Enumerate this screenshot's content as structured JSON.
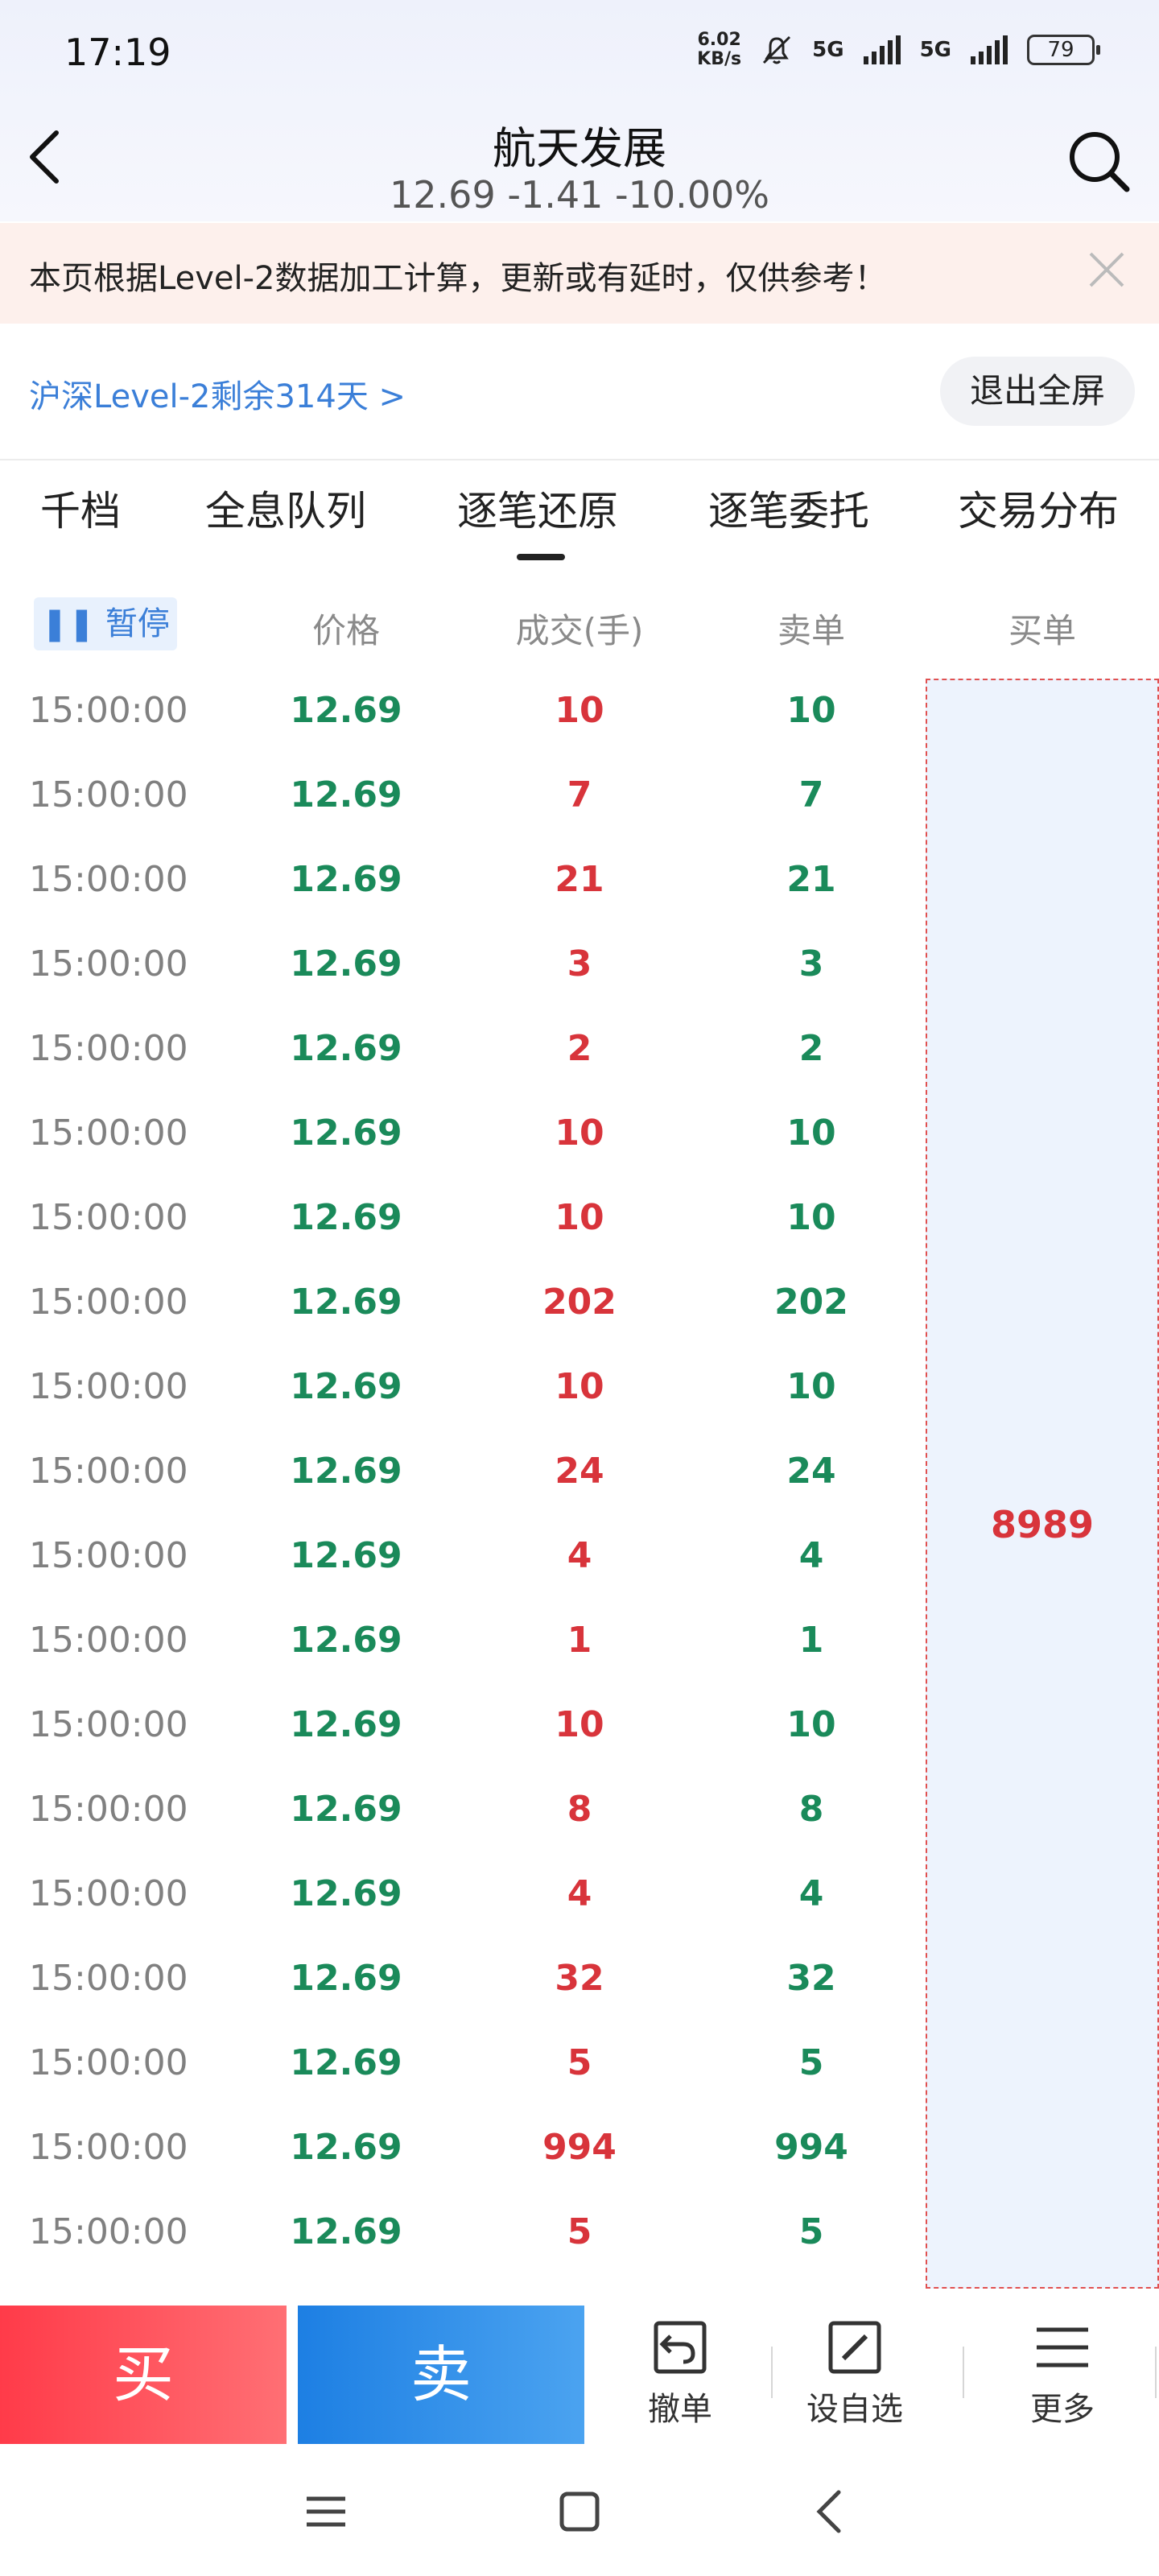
{
  "status_bar": {
    "time": "17:19",
    "net_speed_value": "6.02",
    "net_speed_unit": "KB/s",
    "signal1": "5G",
    "signal2": "5G",
    "battery": "79",
    "icons": [
      "bell-muted-icon",
      "signal-icon",
      "signal-icon",
      "battery-icon"
    ]
  },
  "header": {
    "title": "航天发展",
    "quote": "12.69 -1.41 -10.00%",
    "back_icon": "chevron-left-icon",
    "search_icon": "search-icon"
  },
  "notice": {
    "text": "本页根据Level-2数据加工计算，更新或有延时，仅供参考！",
    "close_icon": "close-icon"
  },
  "level2": {
    "link": "沪深Level-2剩余314天 >",
    "exit_fullscreen": "退出全屏"
  },
  "tabs": [
    {
      "label": "千档"
    },
    {
      "label": "全息队列"
    },
    {
      "label": "逐笔还原",
      "active": true
    },
    {
      "label": "逐笔委托"
    },
    {
      "label": "交易分布"
    }
  ],
  "table": {
    "pause_label": "暂停",
    "headers": [
      "价格",
      "成交(手)",
      "卖单",
      "买单"
    ],
    "rows": [
      {
        "time": "15:00:00",
        "price": "12.69",
        "volume": "10",
        "sell": "10"
      },
      {
        "time": "15:00:00",
        "price": "12.69",
        "volume": "7",
        "sell": "7"
      },
      {
        "time": "15:00:00",
        "price": "12.69",
        "volume": "21",
        "sell": "21"
      },
      {
        "time": "15:00:00",
        "price": "12.69",
        "volume": "3",
        "sell": "3"
      },
      {
        "time": "15:00:00",
        "price": "12.69",
        "volume": "2",
        "sell": "2"
      },
      {
        "time": "15:00:00",
        "price": "12.69",
        "volume": "10",
        "sell": "10"
      },
      {
        "time": "15:00:00",
        "price": "12.69",
        "volume": "10",
        "sell": "10"
      },
      {
        "time": "15:00:00",
        "price": "12.69",
        "volume": "202",
        "sell": "202"
      },
      {
        "time": "15:00:00",
        "price": "12.69",
        "volume": "10",
        "sell": "10"
      },
      {
        "time": "15:00:00",
        "price": "12.69",
        "volume": "24",
        "sell": "24"
      },
      {
        "time": "15:00:00",
        "price": "12.69",
        "volume": "4",
        "sell": "4"
      },
      {
        "time": "15:00:00",
        "price": "12.69",
        "volume": "1",
        "sell": "1"
      },
      {
        "time": "15:00:00",
        "price": "12.69",
        "volume": "10",
        "sell": "10"
      },
      {
        "time": "15:00:00",
        "price": "12.69",
        "volume": "8",
        "sell": "8"
      },
      {
        "time": "15:00:00",
        "price": "12.69",
        "volume": "4",
        "sell": "4"
      },
      {
        "time": "15:00:00",
        "price": "12.69",
        "volume": "32",
        "sell": "32"
      },
      {
        "time": "15:00:00",
        "price": "12.69",
        "volume": "5",
        "sell": "5"
      },
      {
        "time": "15:00:00",
        "price": "12.69",
        "volume": "994",
        "sell": "994"
      },
      {
        "time": "15:00:00",
        "price": "12.69",
        "volume": "5",
        "sell": "5"
      }
    ],
    "buy_order": "8989"
  },
  "actions": {
    "buy": "买",
    "sell": "卖",
    "cancel_order": "撤单",
    "add_watchlist": "设自选",
    "more": "更多"
  },
  "colors": {
    "up_red": "#d8343b",
    "down_green": "#1a8a5a",
    "link_blue": "#3b7fd8",
    "buy_button": "#ff3b49",
    "sell_button": "#1d7fe3"
  }
}
